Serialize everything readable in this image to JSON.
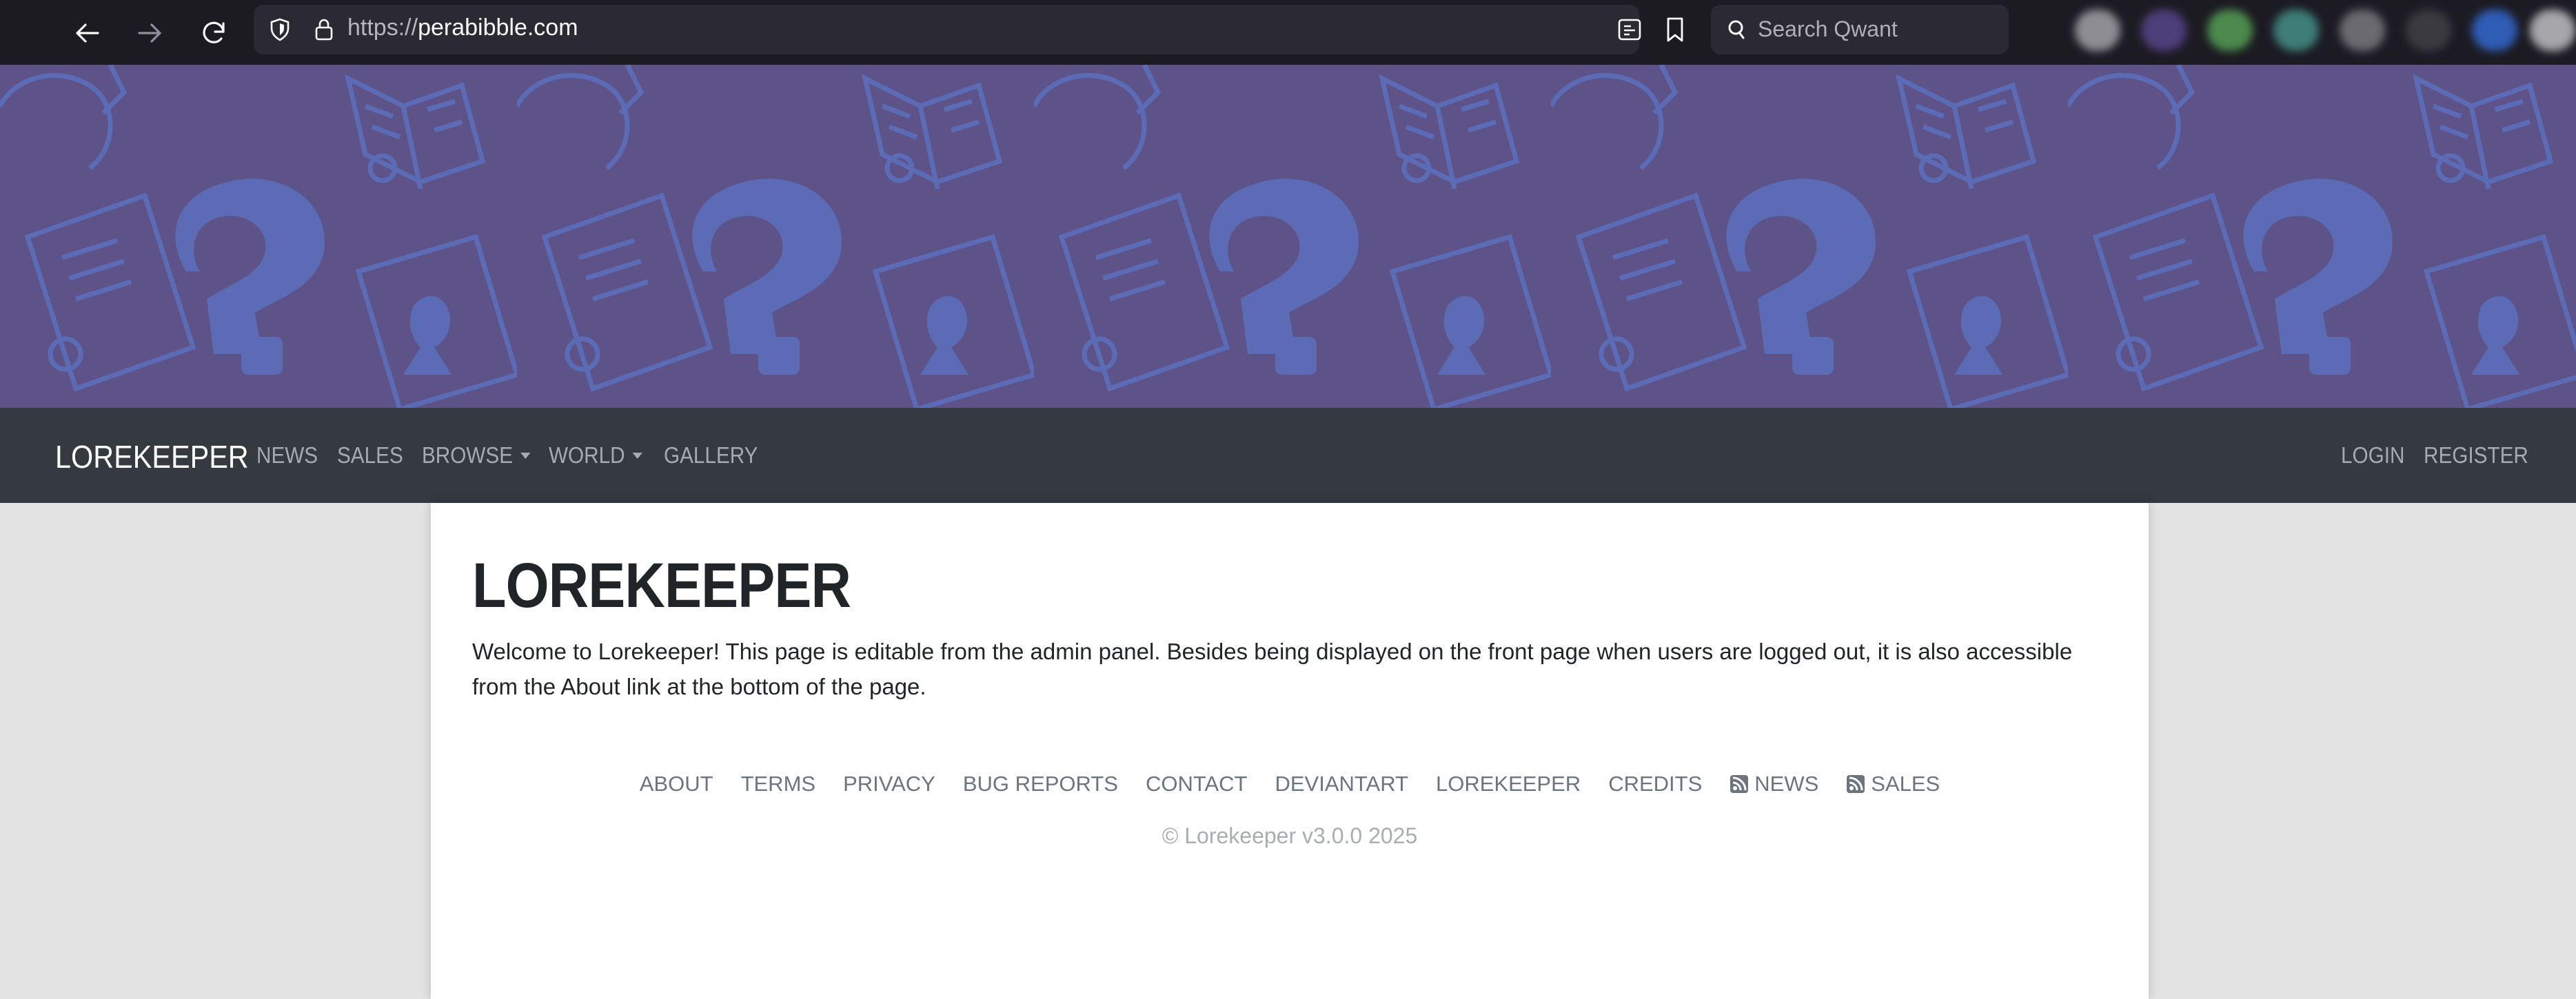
{
  "browser": {
    "url_protocol": "https://",
    "url_host": "perabibble.com",
    "search_placeholder": "Search Qwant",
    "icons": [
      "back-icon",
      "forward-icon",
      "reload-icon",
      "shield-icon",
      "lock-icon",
      "reader-view-icon",
      "bookmark-icon",
      "qwant-icon"
    ]
  },
  "navbar": {
    "brand": "LOREKEEPER",
    "links": [
      {
        "label": "NEWS"
      },
      {
        "label": "SALES"
      },
      {
        "label": "BROWSE"
      },
      {
        "label": "WORLD"
      },
      {
        "label": "GALLERY"
      }
    ],
    "login": "LOGIN",
    "register": "REGISTER"
  },
  "main": {
    "title": "LOREKEEPER",
    "intro": "Welcome to Lorekeeper! This page is editable from the admin panel. Besides being displayed on the front page when users are logged out, it is also accessible from the About link at the bottom of the page."
  },
  "footer": {
    "links": [
      "ABOUT",
      "TERMS",
      "PRIVACY",
      "BUG REPORTS",
      "CONTACT",
      "DEVIANTART",
      "LOREKEEPER",
      "CREDITS"
    ],
    "rss_news": "NEWS",
    "rss_sales": "SALES",
    "copyright": "© Lorekeeper v3.0.0 2025"
  },
  "colors": {
    "banner_bg": "#5d5389",
    "banner_pattern": "#5b6bb5",
    "navbar_bg": "#343a40",
    "browser_bg": "#1c1b22"
  }
}
